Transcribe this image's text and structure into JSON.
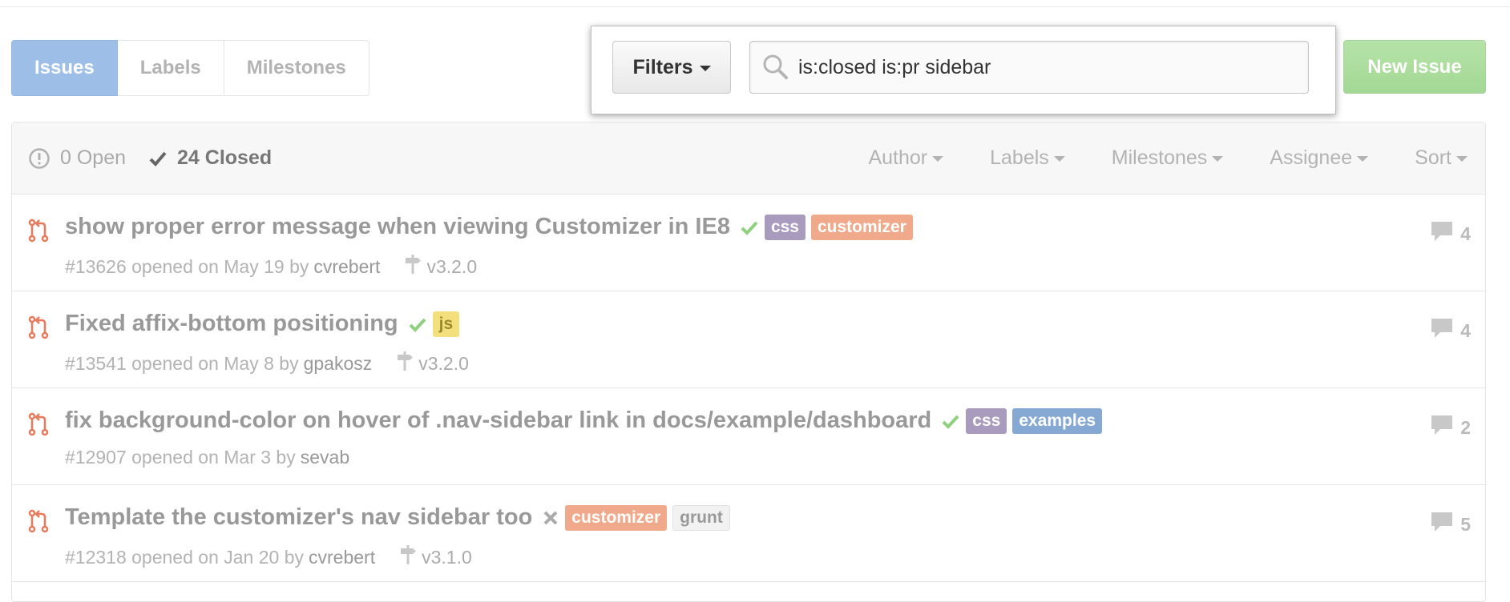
{
  "nav": {
    "tabs": [
      {
        "label": "Issues",
        "active": true
      },
      {
        "label": "Labels",
        "active": false
      },
      {
        "label": "Milestones",
        "active": false
      }
    ]
  },
  "filter_bar": {
    "filters_label": "Filters",
    "search_value": "is:closed is:pr sidebar"
  },
  "new_issue_label": "New Issue",
  "states": {
    "open_label": "0 Open",
    "closed_label": "24 Closed"
  },
  "header_filters": [
    "Author",
    "Labels",
    "Milestones",
    "Assignee",
    "Sort"
  ],
  "colors": {
    "accent_blue": "#9dbfe7",
    "new_issue_green": "#a3d895",
    "pr_icon": "#e8795a",
    "success_check": "#8ed07e"
  },
  "issues": [
    {
      "title": "show proper error message when viewing Customizer in IE8",
      "status": "success",
      "labels": [
        {
          "name": "css",
          "style": "css"
        },
        {
          "name": "customizer",
          "style": "customizer"
        }
      ],
      "number_text": "#13626 opened on May 19 by",
      "author": "cvrebert",
      "milestone": "v3.2.0",
      "comments": "4"
    },
    {
      "title": "Fixed affix-bottom positioning",
      "status": "success",
      "labels": [
        {
          "name": "js",
          "style": "js"
        }
      ],
      "number_text": "#13541 opened on May 8 by",
      "author": "gpakosz",
      "milestone": "v3.2.0",
      "comments": "4"
    },
    {
      "title": "fix background-color on hover of .nav-sidebar link in docs/example/dashboard",
      "status": "success",
      "labels": [
        {
          "name": "css",
          "style": "css"
        },
        {
          "name": "examples",
          "style": "examples"
        }
      ],
      "number_text": "#12907 opened on Mar 3 by",
      "author": "sevab",
      "milestone": "",
      "comments": "2"
    },
    {
      "title": "Template the customizer's nav sidebar too",
      "status": "failure",
      "labels": [
        {
          "name": "customizer",
          "style": "customizer"
        },
        {
          "name": "grunt",
          "style": "grunt"
        }
      ],
      "number_text": "#12318 opened on Jan 20 by",
      "author": "cvrebert",
      "milestone": "v3.1.0",
      "comments": "5"
    }
  ]
}
